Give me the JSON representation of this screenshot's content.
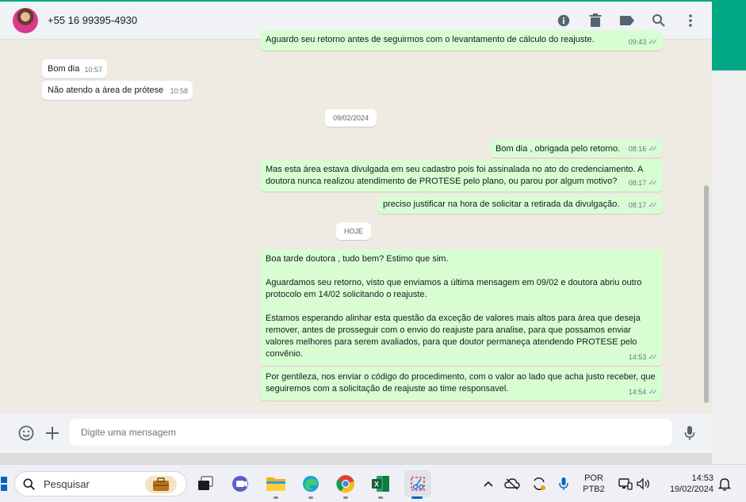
{
  "contact": {
    "name": "+55 16 99395-4930"
  },
  "messages": {
    "m0": {
      "text": "Aguardo seu retorno antes de seguirmos com o levantamento de cálculo do reajuste.",
      "time": "09:43"
    },
    "m1": {
      "text": "Bom dia",
      "time": "10:57"
    },
    "m2": {
      "text": "Não atendo a área de prótese",
      "time": "10:58"
    },
    "date1": "09/02/2024",
    "m3": {
      "text": "Bom dia , obrigada pelo retorno.",
      "time": "08:16"
    },
    "m4": {
      "text": "Mas esta área estava divulgada em seu cadastro pois foi assinalada no ato do credenciamento. A doutora nunca realizou atendimento de PROTESE pelo plano, ou parou por algum motivo?",
      "time": "08:17"
    },
    "m5": {
      "text": "preciso justificar na hora de solicitar a retirada da divulgação.",
      "time": "08:17"
    },
    "date2": "HOJE",
    "m6": {
      "text": "Boa tarde doutora , tudo bem? Estimo que sim.\n\nAguardamos seu retorno, visto que enviamos a última mensagem em 09/02 e doutora abriu outro protocolo em 14/02 solicitando o reajuste.\n\nEstamos esperando alinhar esta questão da exceção de valores mais altos para área que deseja remover, antes de prosseguir com o envio do reajuste para analise, para que possamos enviar valores melhores para serem avaliados, para que doutor permaneça atendendo PROTESE pelo convênio.",
      "time": "14:53"
    },
    "m7": {
      "text": "Por gentileza, nos enviar o código do procedimento, com o valor ao lado que acha justo receber, que seguiremos com a solicitação de reajuste ao time responsavel.",
      "time": "14:54"
    }
  },
  "composer": {
    "placeholder": "Digite uma mensagem"
  },
  "taskbar": {
    "search_label": "Pesquisar",
    "lang_top": "POR",
    "lang_bottom": "PTB2",
    "time": "14:53",
    "date": "19/02/2024"
  },
  "colors": {
    "accent": "#00a884",
    "outgoing_bubble": "#d9fdd3",
    "incoming_bubble": "#ffffff",
    "chat_bg": "#efeae2"
  }
}
